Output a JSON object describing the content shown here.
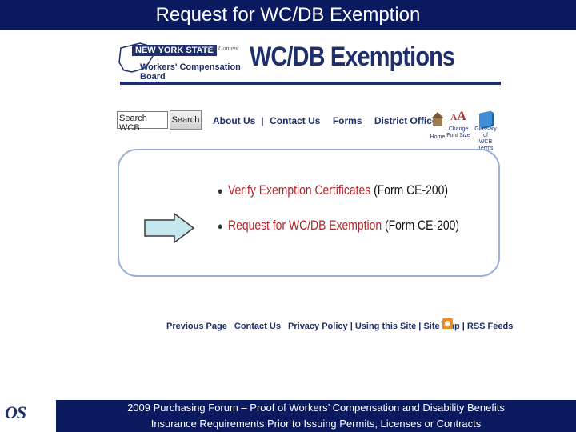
{
  "slide": {
    "title": "Request for WC/DB Exemption",
    "footer_line1": "2009 Purchasing Forum – Proof of Workers’ Compensation and Disability Benefits",
    "footer_line2": "Insurance Requirements Prior to Issuing Permits, Licenses or Contracts",
    "logo_text": "OS"
  },
  "header": {
    "state": "NEW YORK STATE",
    "skip_link": "Skip to Content",
    "board": "Workers' Compensation Board",
    "page_heading": "WC/DB Exemptions"
  },
  "search": {
    "value": "Search WCB",
    "button": "Search"
  },
  "nav": {
    "about": "About Us",
    "contact": "Contact Us",
    "forms": "Forms",
    "offices": "District Offices",
    "separator": "|"
  },
  "tools": {
    "home": "Home",
    "change_font_line1": "Change",
    "change_font_line2": "Font Size",
    "glossary_line1": "Glossary of",
    "glossary_line2": "WCB Terms",
    "aa_glyph": "A",
    "aa_glyph_big": "A"
  },
  "choices": [
    {
      "link": "Verify Exemption Certificates",
      "form": "(Form CE-200)"
    },
    {
      "link": "Request for WC/DB Exemption",
      "form": "(Form CE-200)"
    }
  ],
  "footer_links": {
    "previous": "Previous Page",
    "contact": "Contact Us",
    "privacy": "Privacy Policy",
    "using": "Using this Site",
    "sitemap": "Site Map",
    "rss": "RSS Feeds",
    "separator": "|"
  },
  "colors": {
    "title_bar": "#0b1a5e",
    "link_red": "#b2242a",
    "nav_blue": "#1f2f6b",
    "arrow_fill": "#c6e7ee"
  }
}
